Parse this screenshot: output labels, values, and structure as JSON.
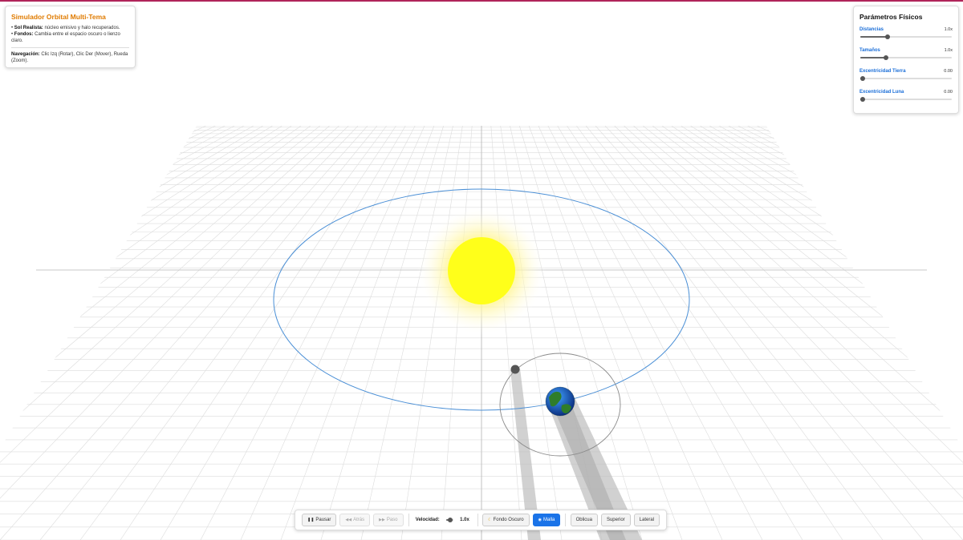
{
  "info": {
    "title": "Simulador Orbital Multi-Tema",
    "sun_label": "Sol Realista:",
    "sun_text": "núcleo emisivo y halo recuperados.",
    "bg_label": "Fondos:",
    "bg_text": "Cambia entre el espacio oscuro o lienzo claro.",
    "nav_label": "Navegación:",
    "nav_text": "Clic Izq (Rotar), Clic Der (Mover), Rueda (Zoom)."
  },
  "params": {
    "title": "Parámetros Físicos",
    "items": [
      {
        "label": "Distancias",
        "value": "1.0x",
        "level": 0.27
      },
      {
        "label": "Tamaños",
        "value": "1.0x",
        "level": 0.25
      },
      {
        "label": "Excentricidad Tierra",
        "value": "0.00",
        "level": 0.0
      },
      {
        "label": "Excentricidad Luna",
        "value": "0.00",
        "level": 0.0
      }
    ]
  },
  "controls": {
    "pause_label": "Pausar",
    "back_label": "Atrás",
    "step_label": "Paso",
    "speed_label": "Velocidad:",
    "speed_value": "1.0x",
    "speed_level": 0.2,
    "dark_bg_label": "Fondo Oscuro",
    "mesh_label": "Malla",
    "oblique_label": "Oblicua",
    "top_label": "Superior",
    "side_label": "Lateral"
  },
  "scene": {
    "grid_color": "#dcdcdc",
    "axis_color": "#b8b8b8",
    "earth_orbit_color": "#4a8fd6",
    "moon_orbit_color": "#8a8a8a",
    "sun_color": "#ffff1a",
    "sun_halo_color": "#fff6a0",
    "earth_land_color": "#2f7d2a",
    "earth_ocean_color": "#1e5bd6",
    "moon_color": "#555555",
    "shadow_color": "#bdbdbd"
  }
}
